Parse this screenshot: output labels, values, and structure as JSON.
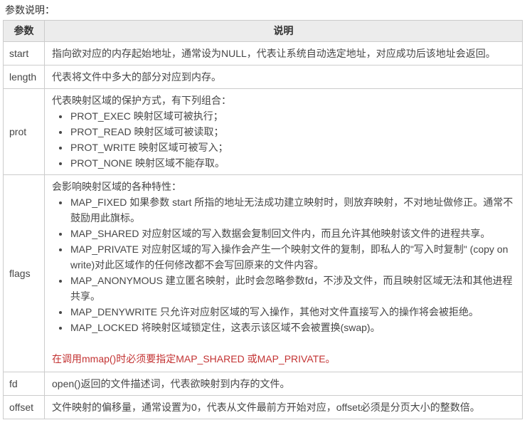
{
  "page": {
    "title": "参数说明："
  },
  "colors": {
    "page_bg": "#ffffff",
    "text": "#464646",
    "heading_text": "#333333",
    "table_border": "#cccccc",
    "header_bg": "#ececec",
    "note_red": "#c33333"
  },
  "table": {
    "headers": [
      "参数",
      "说明"
    ],
    "rows": [
      {
        "param": "start",
        "desc": "指向欲对应的内存起始地址，通常设为NULL，代表让系统自动选定地址，对应成功后该地址会返回。"
      },
      {
        "param": "length",
        "desc": "代表将文件中多大的部分对应到内存。"
      },
      {
        "param": "prot",
        "intro": "代表映射区域的保护方式，有下列组合：",
        "bullets": [
          "PROT_EXEC 映射区域可被执行；",
          "PROT_READ 映射区域可被读取；",
          "PROT_WRITE 映射区域可被写入；",
          "PROT_NONE 映射区域不能存取。"
        ]
      },
      {
        "param": "flags",
        "intro": "会影响映射区域的各种特性：",
        "bullets": [
          "MAP_FIXED 如果参数 start 所指的地址无法成功建立映射时，则放弃映射，不对地址做修正。通常不鼓励用此旗标。",
          "MAP_SHARED 对应射区域的写入数据会复制回文件内，而且允许其他映射该文件的进程共享。",
          "MAP_PRIVATE 对应射区域的写入操作会产生一个映射文件的复制，即私人的\"写入时复制\" (copy on write)对此区域作的任何修改都不会写回原来的文件内容。",
          "MAP_ANONYMOUS 建立匿名映射，此时会忽略参数fd，不涉及文件，而且映射区域无法和其他进程共享。",
          "MAP_DENYWRITE 只允许对应射区域的写入操作，其他对文件直接写入的操作将会被拒绝。",
          "MAP_LOCKED 将映射区域锁定住，这表示该区域不会被置换(swap)。"
        ],
        "note": "在调用mmap()时必须要指定MAP_SHARED 或MAP_PRIVATE。"
      },
      {
        "param": "fd",
        "desc": "open()返回的文件描述词，代表欲映射到内存的文件。"
      },
      {
        "param": "offset",
        "desc": "文件映射的偏移量，通常设置为0，代表从文件最前方开始对应，offset必须是分页大小的整数倍。"
      }
    ]
  }
}
